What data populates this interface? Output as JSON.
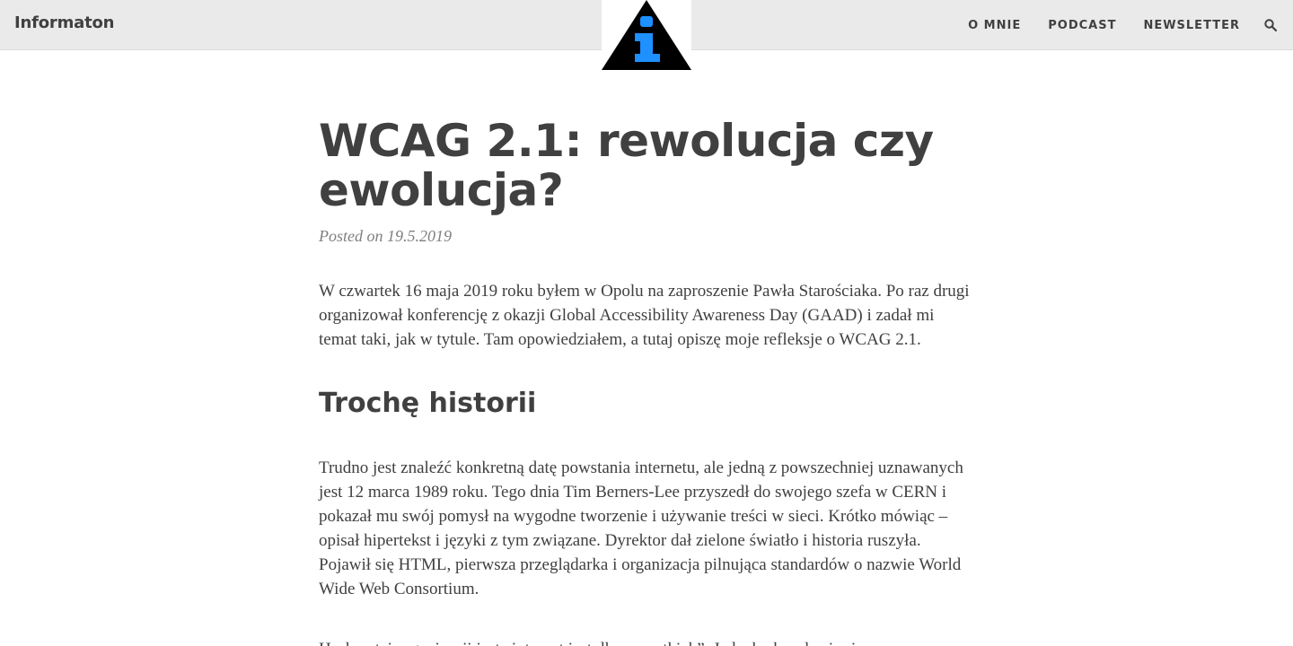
{
  "navbar": {
    "brand": "Informaton",
    "links": [
      "O MNIE",
      "PODCAST",
      "NEWSLETTER"
    ],
    "search_icon": "search-icon",
    "logo_icon": "info-triangle-logo"
  },
  "colors": {
    "navbar_bg": "#eaeaea",
    "text": "#404040",
    "meta": "#808080",
    "logo_triangle": "#000000",
    "logo_i": "#1e90ff"
  },
  "post": {
    "title": "WCAG 2.1: rewolucja czy ewolucja?",
    "meta": "Posted on 19.5.2019",
    "paragraphs": [
      "W czwartek 16 maja 2019 roku byłem w Opolu na zaproszenie Pawła Starościaka. Po raz drugi organizował konferencję z okazji Global Accessibility Awareness Day (GAAD) i zadał mi temat taki, jak w tytule. Tam opowiedziałem, a tutaj opiszę moje refleksje o WCAG 2.1.",
      "Trudno jest znaleźć konkretną datę powstania internetu, ale jedną z powszechniej uznawanych jest 12 marca 1989 roku. Tego dnia Tim Berners-Lee przyszedł do swojego szefa w CERN i pokazał mu swój pomysł na wygodne tworzenie i używanie treści w sieci. Krótko mówiąc – opisał hipertekst i języki z tym związane. Dyrektor dał zielone światło i historia ruszyła. Pojawił się HTML, pierwsza przeglądarka i organizacja pilnująca standardów o nazwie World Wide Web Consortium.",
      "Hasłem tej organizacji jest „internet jest dla wszystkich”. Jednak okazało się, że"
    ],
    "section_heading": "Trochę historii"
  }
}
